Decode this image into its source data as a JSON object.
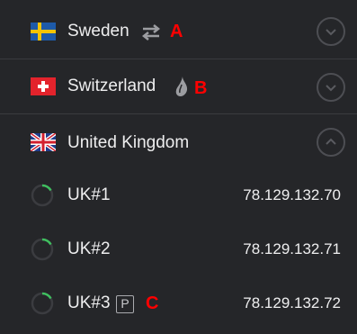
{
  "countries": [
    {
      "name": "Sweden",
      "flag": "flag-sweden",
      "feature_icon": "arrows-exchange-icon",
      "tag": "A",
      "expanded": false
    },
    {
      "name": "Switzerland",
      "flag": "flag-switzerland",
      "feature_icon": "onion-icon",
      "tag": "B",
      "expanded": false
    },
    {
      "name": "United Kingdom",
      "flag": "flag-united-kingdom",
      "expanded": true,
      "servers": [
        {
          "name": "UK#1",
          "ip": "78.129.132.70",
          "load_icon": "server-load-icon"
        },
        {
          "name": "UK#2",
          "ip": "78.129.132.71",
          "load_icon": "server-load-icon"
        },
        {
          "name": "UK#3",
          "ip": "78.129.132.72",
          "load_icon": "server-load-icon",
          "badge": "P",
          "tag": "C"
        }
      ]
    }
  ],
  "colors": {
    "background": "#252629",
    "separator": "#3a3b3f",
    "text": "#eeeeef",
    "annotation": "#ff0000",
    "load_indicator": "#3fbf5f"
  }
}
